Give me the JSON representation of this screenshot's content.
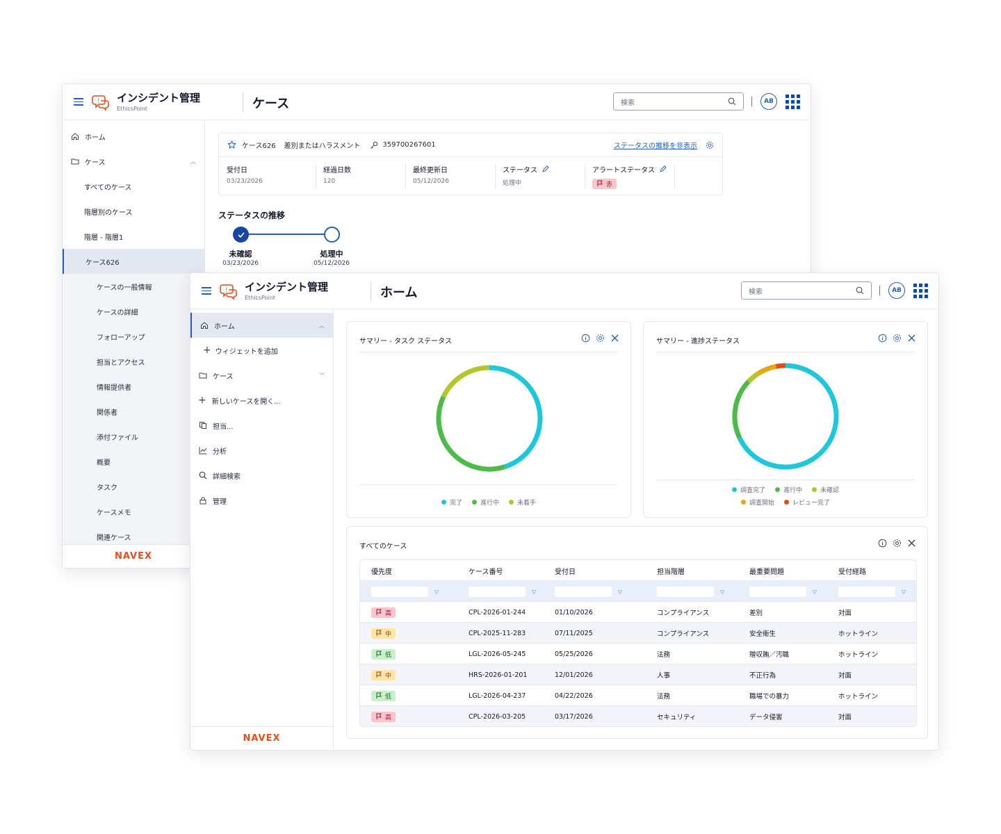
{
  "app": {
    "title": "インシデント管理",
    "subtitle": "EthicsPoint",
    "search_placeholder": "検索",
    "avatar_initials": "AB",
    "brand": "NAVEX",
    "brand_color": "#e94e1b",
    "accent_color": "#1f5fbf"
  },
  "back_window": {
    "page_title": "ケース",
    "sidebar": {
      "home": "ホーム",
      "cases": "ケース",
      "items": [
        "すべてのケース",
        "階層別のケース",
        "階層 - 階層1",
        "ケース626"
      ],
      "sub_items": [
        "ケースの一般情報",
        "ケースの詳細",
        "フォローアップ",
        "担当とアクセス",
        "情報提供者",
        "関係者",
        "添付ファイル",
        "概要",
        "タスク",
        "ケースメモ",
        "関連ケース"
      ]
    },
    "case": {
      "id": "ケース626",
      "category": "差別またはハラスメント",
      "access_key": "359700267601",
      "toggle_link": "ステータスの推移を非表示",
      "fields": {
        "received_label": "受付日",
        "received_value": "03/23/2026",
        "elapsed_label": "経過日数",
        "elapsed_value": "120",
        "updated_label": "最終更新日",
        "updated_value": "05/12/2026",
        "status_label": "ステータス",
        "status_value": "処理中",
        "alert_label": "アラートステータス",
        "alert_value": "赤"
      }
    },
    "status_history": {
      "title": "ステータスの推移",
      "steps": [
        {
          "label": "未確認",
          "date": "03/23/2026",
          "done": true
        },
        {
          "label": "処理中",
          "date": "05/12/2026",
          "done": false
        }
      ]
    }
  },
  "front_window": {
    "page_title": "ホーム",
    "sidebar": {
      "home": "ホーム",
      "add_widget": "ウィジェットを追加",
      "cases": "ケース",
      "new_case": "新しいケースを開く...",
      "assign": "担当...",
      "analytics": "分析",
      "advanced_search": "詳細検索",
      "admin": "管理"
    },
    "widget_task": {
      "title": "サマリー - タスク ステータス",
      "legend": [
        {
          "name": "完了",
          "color": "#1ec8dc"
        },
        {
          "name": "進行中",
          "color": "#4cbb4a"
        },
        {
          "name": "未着手",
          "color": "#b5c62a"
        }
      ]
    },
    "widget_progress": {
      "title": "サマリー - 進捗ステータス",
      "legend": [
        {
          "name": "調査完了",
          "color": "#1ec8dc"
        },
        {
          "name": "進行中",
          "color": "#4cbb4a"
        },
        {
          "name": "未確認",
          "color": "#b5c62a"
        },
        {
          "name": "調査開始",
          "color": "#eaa60f"
        },
        {
          "name": "レビュー完了",
          "color": "#ea4a12"
        }
      ]
    },
    "all_cases": {
      "title": "すべてのケース",
      "columns": [
        "優先度",
        "ケース番号",
        "受付日",
        "担当階層",
        "最重要問題",
        "受付経路"
      ],
      "rows": [
        {
          "priority": "高",
          "level": "high",
          "number": "CPL-2026-01-244",
          "date": "01/10/2026",
          "tier": "コンプライアンス",
          "issue": "差別",
          "channel": "対面"
        },
        {
          "priority": "中",
          "level": "mid",
          "number": "CPL-2025-11-283",
          "date": "07/11/2025",
          "tier": "コンプライアンス",
          "issue": "安全衛生",
          "channel": "ホットライン"
        },
        {
          "priority": "低",
          "level": "low",
          "number": "LGL-2026-05-245",
          "date": "05/25/2026",
          "tier": "法務",
          "issue": "贈収賄／汚職",
          "channel": "ホットライン"
        },
        {
          "priority": "中",
          "level": "mid",
          "number": "HRS-2026-01-201",
          "date": "12/01/2026",
          "tier": "人事",
          "issue": "不正行為",
          "channel": "対面"
        },
        {
          "priority": "低",
          "level": "low",
          "number": "LGL-2026-04-237",
          "date": "04/22/2026",
          "tier": "法務",
          "issue": "職場での暴力",
          "channel": "ホットライン"
        },
        {
          "priority": "高",
          "level": "high",
          "number": "CPL-2026-03-205",
          "date": "03/17/2026",
          "tier": "セキュリティ",
          "issue": "データ侵害",
          "channel": "対面"
        }
      ]
    }
  },
  "chart_data": [
    {
      "type": "pie",
      "title": "サマリー - タスク ステータス",
      "categories": [
        "完了",
        "進行中",
        "未着手"
      ],
      "values": [
        45,
        37,
        18
      ]
    },
    {
      "type": "pie",
      "title": "サマリー - 進捗ステータス",
      "categories": [
        "調査完了",
        "進行中",
        "未確認",
        "調査開始",
        "レビュー完了"
      ],
      "values": [
        68,
        19,
        4,
        6,
        3
      ]
    }
  ]
}
